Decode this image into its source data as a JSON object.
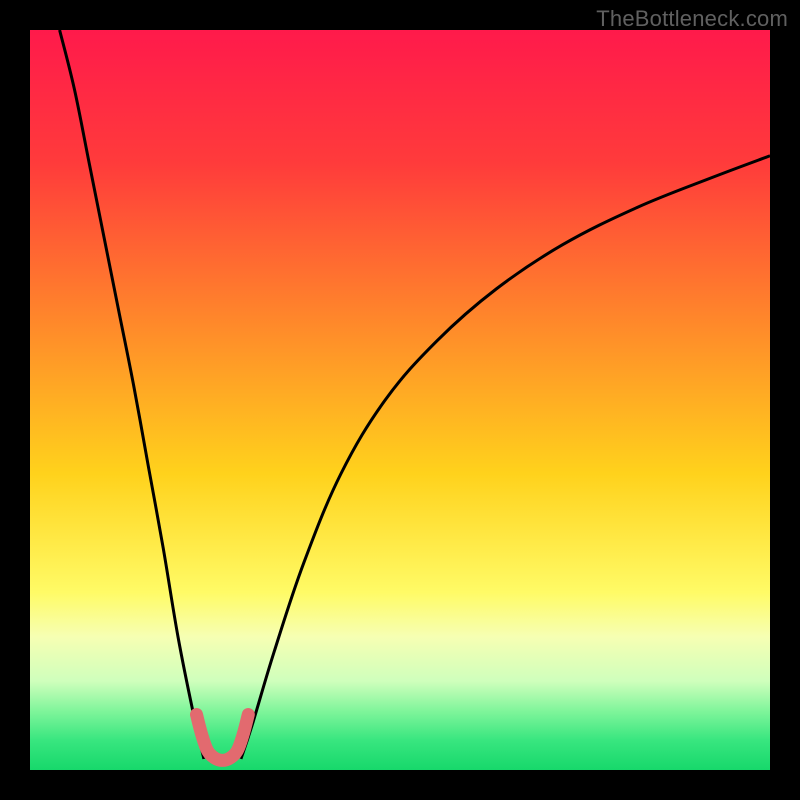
{
  "watermark": "TheBottleneck.com",
  "chart_data": {
    "type": "line",
    "title": "",
    "xlabel": "",
    "ylabel": "",
    "xlim": [
      0,
      100
    ],
    "ylim": [
      0,
      100
    ],
    "gradient_stops": [
      {
        "offset": 0,
        "color": "#ff1a4b"
      },
      {
        "offset": 18,
        "color": "#ff3b3b"
      },
      {
        "offset": 40,
        "color": "#ff8a2a"
      },
      {
        "offset": 60,
        "color": "#ffd21c"
      },
      {
        "offset": 76,
        "color": "#fffb66"
      },
      {
        "offset": 82,
        "color": "#f6ffb3"
      },
      {
        "offset": 88,
        "color": "#cfffbc"
      },
      {
        "offset": 92,
        "color": "#80f59b"
      },
      {
        "offset": 96,
        "color": "#38e67f"
      },
      {
        "offset": 100,
        "color": "#17d86b"
      }
    ],
    "series": [
      {
        "name": "curve-left",
        "x": [
          4,
          6,
          8,
          10,
          12,
          14,
          16,
          18,
          20,
          22,
          23.5
        ],
        "y": [
          100,
          92,
          82,
          72,
          62,
          52,
          41,
          30,
          18,
          8,
          1.5
        ]
      },
      {
        "name": "curve-right",
        "x": [
          28.5,
          30,
          33,
          37,
          42,
          48,
          55,
          63,
          72,
          82,
          92,
          100
        ],
        "y": [
          1.5,
          6,
          16,
          28,
          40,
          50,
          58,
          65,
          71,
          76,
          80,
          83
        ]
      },
      {
        "name": "valley-pink",
        "stroke": "#e26a6f",
        "stroke_width": 13,
        "linecap": "round",
        "x": [
          22.5,
          23.2,
          24.0,
          25.0,
          26.0,
          27.0,
          28.0,
          28.8,
          29.5
        ],
        "y": [
          7.5,
          4.8,
          2.6,
          1.6,
          1.3,
          1.6,
          2.6,
          4.8,
          7.5
        ]
      }
    ]
  }
}
